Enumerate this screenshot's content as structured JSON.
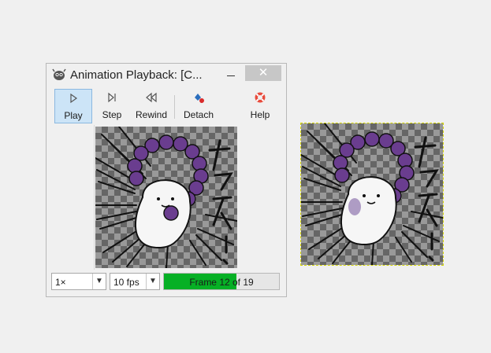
{
  "window": {
    "title": "Animation Playback: [C...",
    "close_glyph": "✕"
  },
  "toolbar": {
    "buttons": [
      {
        "label": "Play",
        "icon": "play-icon",
        "active": true
      },
      {
        "label": "Step",
        "icon": "step-icon"
      },
      {
        "label": "Rewind",
        "icon": "rewind-icon"
      },
      {
        "label": "Detach",
        "icon": "detach-icon"
      },
      {
        "label": "Help",
        "icon": "help-lifebuoy-icon"
      }
    ]
  },
  "controls": {
    "zoom": "1×",
    "fps": "10 fps",
    "frame_text": "Frame 12 of 19",
    "frame_current": 12,
    "frame_total": 19
  },
  "colors": {
    "progress_fill": "#06b025",
    "active_button": "#cce4f7",
    "canvas_border": "#d4d400",
    "sprite_purple": "#6a3d8f"
  }
}
